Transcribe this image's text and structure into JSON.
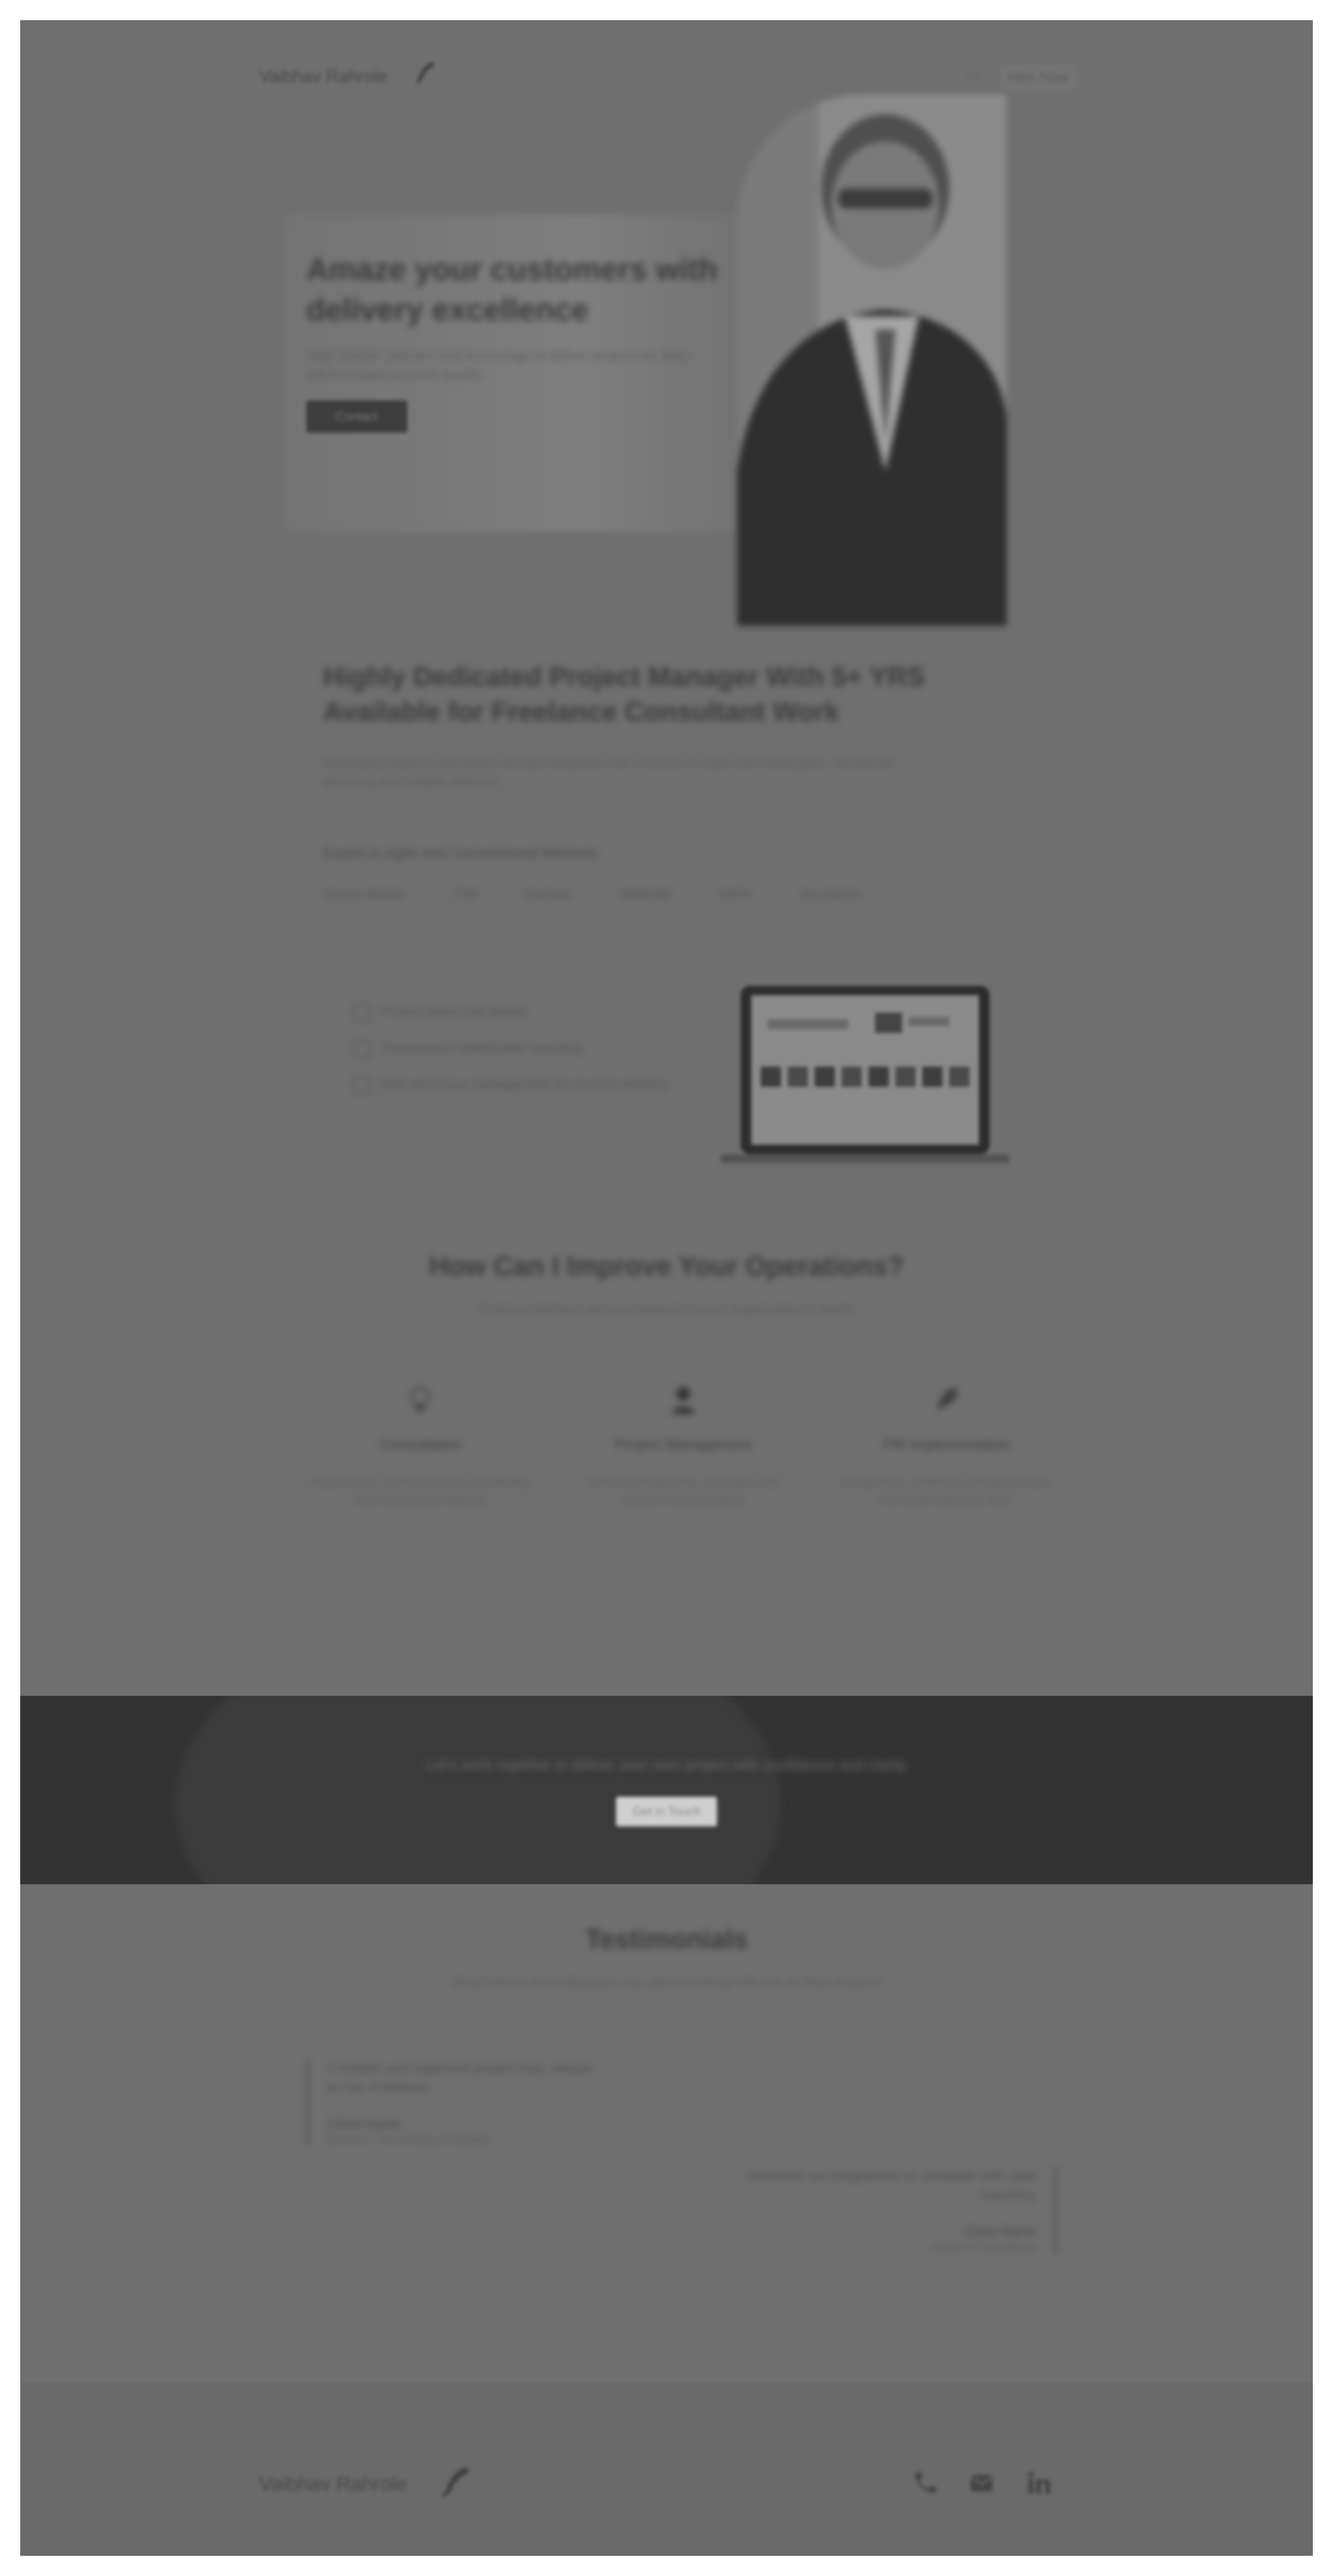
{
  "header": {
    "brand": "Vaibhav Rahrole",
    "nav_link": "◦ ◦",
    "cta": "Hire Now"
  },
  "hero": {
    "title": "Amaze your customers with delivery excellence",
    "subtitle": "Align people, process and technology to deliver projects on time, within budget and with quality",
    "cta": "Contact"
  },
  "intro": {
    "title": "Highly Dedicated Project Manager With 5+ YRS Available for Freelance Consultant Work",
    "body": "Managing projects and teams across industries with a focus on clear communication, structured planning and reliable delivery.",
    "skills_label": "Expert in Agile and Conventional Methods",
    "skills": [
      "Scrum Master",
      "PMI",
      "Kanban",
      "Waterfall",
      "SAFe",
      "Jira Admin"
    ]
  },
  "checklist": [
    "Project plans that deliver",
    "Transparent stakeholder reporting",
    "Risk and issue management for on-time delivery"
  ],
  "operations": {
    "title": "How Can I Improve Your Operations?",
    "subtitle": "Practical delivery services tailored to your organisation's needs",
    "cards": [
      {
        "title": "Consultation",
        "text": "Assess your current process and identify improvements to delivery"
      },
      {
        "title": "Project Management",
        "text": "End-to-end planning, execution and control of your projects"
      },
      {
        "title": "PM Implementation",
        "text": "Set up tools, workflows and governance that scale with your team"
      }
    ]
  },
  "banner": {
    "text": "Let's work together to deliver your next project with confidence and clarity",
    "cta": "Get in Touch"
  },
  "testimonials": {
    "title": "Testimonials",
    "subtitle": "What clients and colleagues say about working with me on their projects",
    "items": [
      {
        "quote": "A reliable and organised project lead, always on top of delivery.",
        "name": "Client Name",
        "role": "Director, Technology Company"
      },
      {
        "quote": "Delivered our programme on schedule with clear reporting.",
        "name": "Client Name",
        "role": "Head of Operations"
      }
    ]
  },
  "footer": {
    "brand": "Vaibhav Rahrole",
    "icons": [
      "phone-icon",
      "email-icon",
      "linkedin-icon"
    ]
  }
}
